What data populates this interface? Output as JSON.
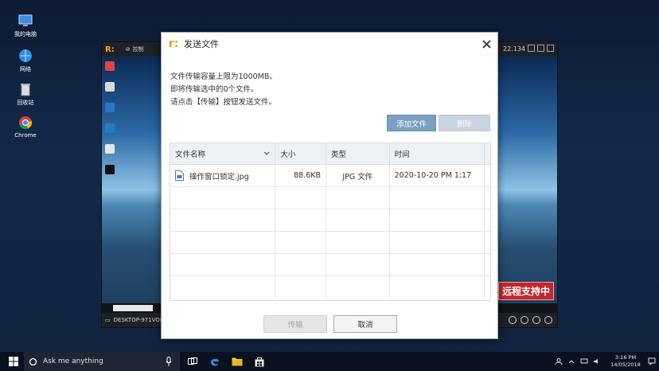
{
  "desktop": {
    "icons": [
      {
        "label": "我的电脑",
        "icon": "computer-icon"
      },
      {
        "label": "网络",
        "icon": "network-icon"
      },
      {
        "label": "回收站",
        "icon": "recycle-bin-icon"
      },
      {
        "label": "Chrome",
        "icon": "chrome-icon"
      }
    ]
  },
  "remote_window": {
    "control_label": "控制",
    "ip_fragment": "22.134",
    "host_label": "DESKTOP-971VON",
    "badge": "远程支持中"
  },
  "dialog": {
    "title": "发送文件",
    "info_lines": [
      "文件传输容量上限为1000MB。",
      "即将传输选中的0个文件。",
      "请点击【传输】按钮发送文件。"
    ],
    "add_button": "添加文件",
    "delete_button": "删除",
    "table": {
      "headers": [
        "文件名称",
        "大小",
        "类型",
        "时间"
      ],
      "rows": [
        {
          "name": "操作窗口锁定.jpg",
          "size": "88.6KB",
          "type": "JPG 文件",
          "time": "2020-10-20 PM 1:17"
        }
      ]
    },
    "transfer_button": "传输",
    "cancel_button": "取消",
    "colors": {
      "accent": "#7a9fc0",
      "logo": "#f39a1e"
    }
  },
  "taskbar": {
    "search_placeholder": "Ask me anything",
    "time": "3:16 PM",
    "date": "14/05/2018",
    "apps": [
      "task-view-icon",
      "edge-icon",
      "file-explorer-icon",
      "store-icon"
    ]
  }
}
